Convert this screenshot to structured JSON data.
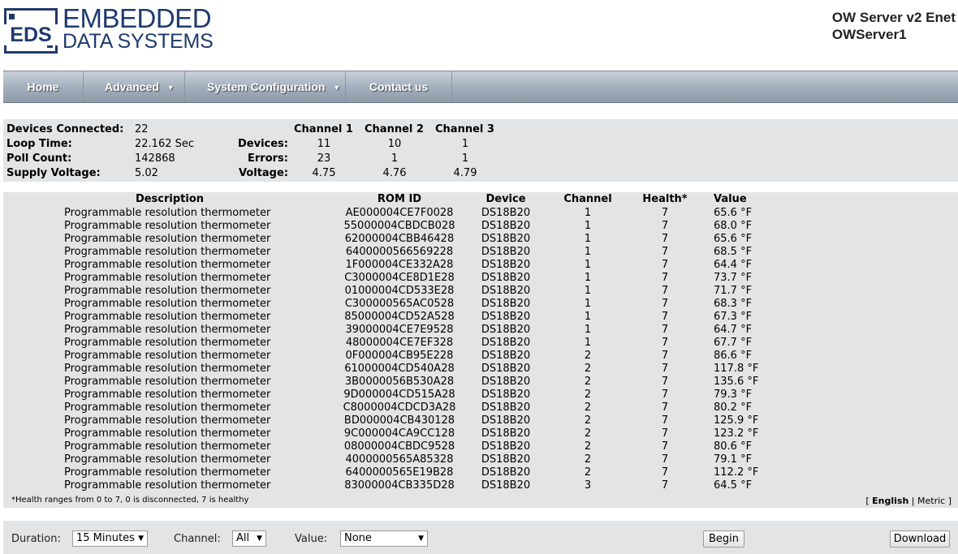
{
  "header": {
    "logo_abbr": "EDS",
    "logo_line1": "EMBEDDED",
    "logo_line2": "DATA SYSTEMS",
    "product": "OW Server v2 Enet",
    "server_name": "OWServer1"
  },
  "nav": {
    "home": "Home",
    "advanced": "Advanced",
    "system_configuration": "System Configuration",
    "contact": "Contact us",
    "chevron_icon": "chevron-down-icon"
  },
  "summary": {
    "devices_connected_label": "Devices Connected:",
    "devices_connected": "22",
    "loop_time_label": "Loop Time:",
    "loop_time": "22.162 Sec",
    "poll_count_label": "Poll Count:",
    "poll_count": "142868",
    "supply_voltage_label": "Supply Voltage:",
    "supply_voltage": "5.02",
    "devices_label": "Devices:",
    "errors_label": "Errors:",
    "voltage_label": "Voltage:",
    "channels": [
      {
        "name": "Channel 1",
        "devices": "11",
        "errors": "23",
        "voltage": "4.75"
      },
      {
        "name": "Channel 2",
        "devices": "10",
        "errors": "1",
        "voltage": "4.76"
      },
      {
        "name": "Channel 3",
        "devices": "1",
        "errors": "1",
        "voltage": "4.79"
      }
    ]
  },
  "table": {
    "headers": {
      "description": "Description",
      "rom_id": "ROM ID",
      "device": "Device",
      "channel": "Channel",
      "health": "Health*",
      "value": "Value"
    },
    "rows": [
      {
        "description": "Programmable resolution thermometer",
        "rom_id": "AE000004CE7F0028",
        "device": "DS18B20",
        "channel": "1",
        "health": "7",
        "value": "65.6 °F"
      },
      {
        "description": "Programmable resolution thermometer",
        "rom_id": "55000004CBDCB028",
        "device": "DS18B20",
        "channel": "1",
        "health": "7",
        "value": "68.0 °F"
      },
      {
        "description": "Programmable resolution thermometer",
        "rom_id": "62000004CBB46428",
        "device": "DS18B20",
        "channel": "1",
        "health": "7",
        "value": "65.6 °F"
      },
      {
        "description": "Programmable resolution thermometer",
        "rom_id": "6400000566569228",
        "device": "DS18B20",
        "channel": "1",
        "health": "7",
        "value": "68.5 °F"
      },
      {
        "description": "Programmable resolution thermometer",
        "rom_id": "1F000004CE332A28",
        "device": "DS18B20",
        "channel": "1",
        "health": "7",
        "value": "64.4 °F"
      },
      {
        "description": "Programmable resolution thermometer",
        "rom_id": "C3000004CE8D1E28",
        "device": "DS18B20",
        "channel": "1",
        "health": "7",
        "value": "73.7 °F"
      },
      {
        "description": "Programmable resolution thermometer",
        "rom_id": "01000004CD533E28",
        "device": "DS18B20",
        "channel": "1",
        "health": "7",
        "value": "71.7 °F"
      },
      {
        "description": "Programmable resolution thermometer",
        "rom_id": "C300000565AC0528",
        "device": "DS18B20",
        "channel": "1",
        "health": "7",
        "value": "68.3 °F"
      },
      {
        "description": "Programmable resolution thermometer",
        "rom_id": "85000004CD52A528",
        "device": "DS18B20",
        "channel": "1",
        "health": "7",
        "value": "67.3 °F"
      },
      {
        "description": "Programmable resolution thermometer",
        "rom_id": "39000004CE7E9528",
        "device": "DS18B20",
        "channel": "1",
        "health": "7",
        "value": "64.7 °F"
      },
      {
        "description": "Programmable resolution thermometer",
        "rom_id": "48000004CE7EF328",
        "device": "DS18B20",
        "channel": "1",
        "health": "7",
        "value": "67.7 °F"
      },
      {
        "description": "Programmable resolution thermometer",
        "rom_id": "0F000004CB95E228",
        "device": "DS18B20",
        "channel": "2",
        "health": "7",
        "value": "86.6 °F"
      },
      {
        "description": "Programmable resolution thermometer",
        "rom_id": "61000004CD540A28",
        "device": "DS18B20",
        "channel": "2",
        "health": "7",
        "value": "117.8 °F"
      },
      {
        "description": "Programmable resolution thermometer",
        "rom_id": "3B0000056B530A28",
        "device": "DS18B20",
        "channel": "2",
        "health": "7",
        "value": "135.6 °F"
      },
      {
        "description": "Programmable resolution thermometer",
        "rom_id": "9D000004CD515A28",
        "device": "DS18B20",
        "channel": "2",
        "health": "7",
        "value": "79.3 °F"
      },
      {
        "description": "Programmable resolution thermometer",
        "rom_id": "C8000004CDCD3A28",
        "device": "DS18B20",
        "channel": "2",
        "health": "7",
        "value": "80.2 °F"
      },
      {
        "description": "Programmable resolution thermometer",
        "rom_id": "BD000004CB430128",
        "device": "DS18B20",
        "channel": "2",
        "health": "7",
        "value": "125.9 °F"
      },
      {
        "description": "Programmable resolution thermometer",
        "rom_id": "9C000004CA9CC128",
        "device": "DS18B20",
        "channel": "2",
        "health": "7",
        "value": "123.2 °F"
      },
      {
        "description": "Programmable resolution thermometer",
        "rom_id": "08000004CBDC9528",
        "device": "DS18B20",
        "channel": "2",
        "health": "7",
        "value": "80.6 °F"
      },
      {
        "description": "Programmable resolution thermometer",
        "rom_id": "4000000565A85328",
        "device": "DS18B20",
        "channel": "2",
        "health": "7",
        "value": "79.1 °F"
      },
      {
        "description": "Programmable resolution thermometer",
        "rom_id": "6400000565E19B28",
        "device": "DS18B20",
        "channel": "2",
        "health": "7",
        "value": "112.2 °F"
      },
      {
        "description": "Programmable resolution thermometer",
        "rom_id": "83000004CB335D28",
        "device": "DS18B20",
        "channel": "3",
        "health": "7",
        "value": "64.5 °F"
      }
    ],
    "health_note": "*Health ranges from 0 to 7, 0 is disconnected, 7 is healthy",
    "units": {
      "open": "[",
      "english": "English",
      "sep": "|",
      "metric": "Metric",
      "close": "]"
    }
  },
  "controls": {
    "duration_label": "Duration:",
    "duration_value": "15 Minutes",
    "channel_label": "Channel:",
    "channel_value": "All",
    "value_label": "Value:",
    "value_value": "None",
    "begin": "Begin",
    "download": "Download",
    "select_arrow": "▼"
  }
}
